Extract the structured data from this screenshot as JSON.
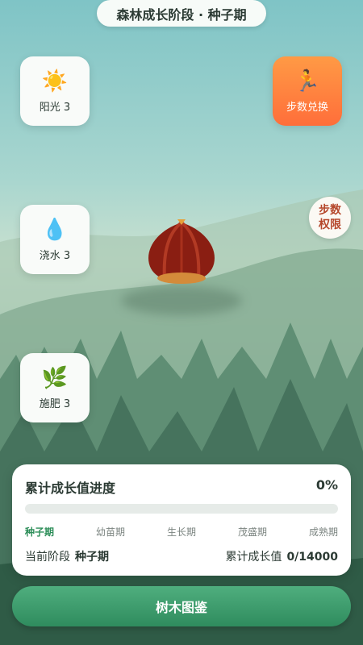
{
  "header": {
    "title": "森林成长阶段 · 种子期"
  },
  "actions": {
    "sunlight": {
      "icon": "sun-icon",
      "label": "阳光 3"
    },
    "water": {
      "icon": "water-drop-icon",
      "label": "浇水 3"
    },
    "fertilize": {
      "icon": "leaf-icon",
      "label": "施肥 3"
    },
    "step_exchange": {
      "icon": "running-icon",
      "label": "步数兑换"
    }
  },
  "permission": {
    "line1": "步数",
    "line2": "权限"
  },
  "progress": {
    "title": "累计成长值进度",
    "percent_label": "0%",
    "percent": 0,
    "stages": [
      "种子期",
      "幼苗期",
      "生长期",
      "茂盛期",
      "成熟期"
    ],
    "active_stage": 0,
    "current_stage_label": "当前阶段",
    "current_stage_value": "种子期",
    "accumulated_label": "累计成长值",
    "accumulated_value": "0/14000"
  },
  "footer": {
    "button_label": "树木图鉴"
  },
  "colors": {
    "accent_green": "#2f8c5e",
    "exchange_orange": "#ff7a3d",
    "permission_red": "#b5472b"
  }
}
